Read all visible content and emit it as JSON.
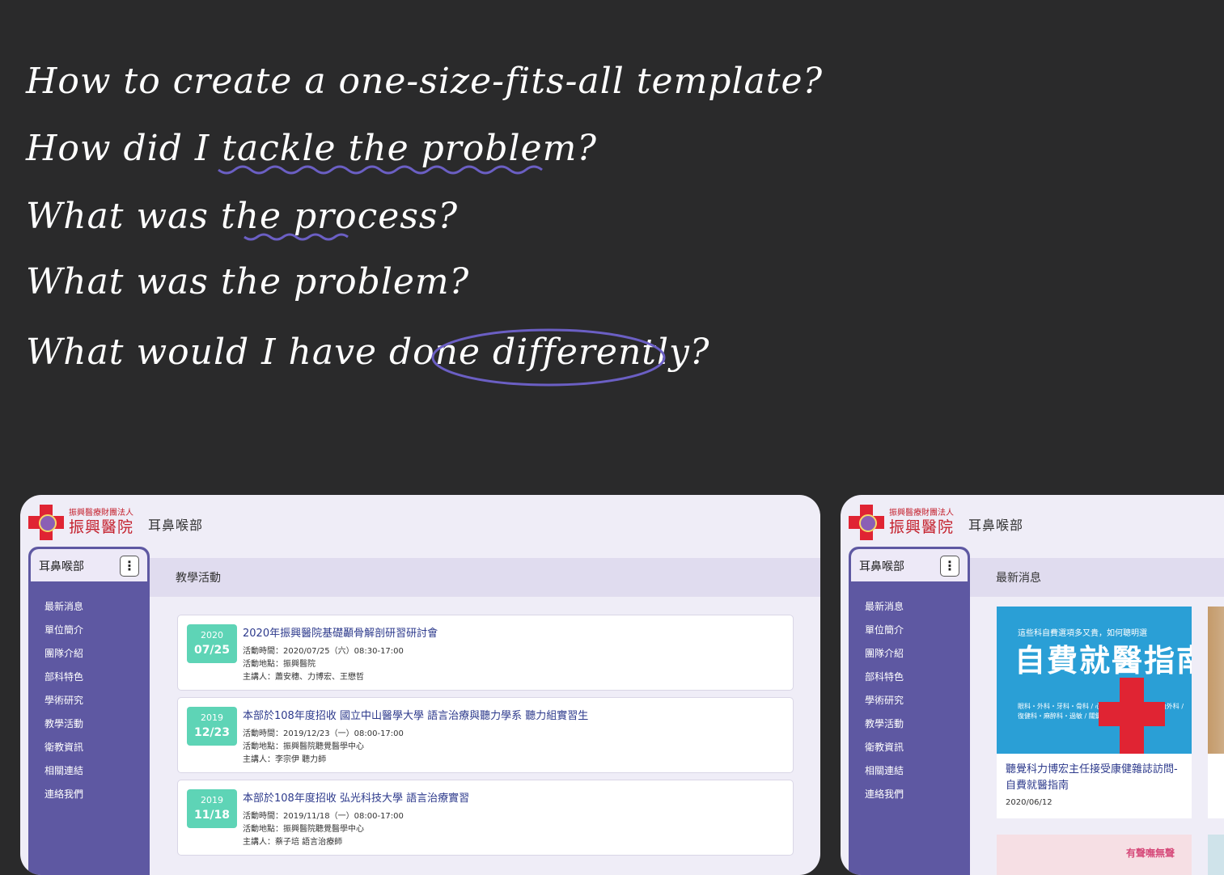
{
  "notes": [
    "How to create a one-size-fits-all template?",
    "How did I tackle the problem?",
    "What was the process?",
    "What was the problem?",
    "What would I have done differently?"
  ],
  "brand": {
    "foundation": "振興醫療財團法人",
    "hospital": "振興醫院",
    "department": "耳鼻喉部"
  },
  "sidebar": {
    "title": "耳鼻喉部",
    "items": [
      "最新消息",
      "單位簡介",
      "團隊介紹",
      "部科特色",
      "學術研究",
      "教學活動",
      "衛教資訊",
      "相關連結",
      "連絡我們"
    ]
  },
  "window1": {
    "header": "教學活動",
    "events": [
      {
        "year": "2020",
        "md": "07/25",
        "title": "2020年振興醫院基礎顳骨解剖研習研討會",
        "time": "活動時間：2020/07/25（六）08:30-17:00",
        "place": "活動地點：振興醫院",
        "speaker": "主講人：蕭安穗、力博宏、王懋哲"
      },
      {
        "year": "2019",
        "md": "12/23",
        "title": "本部於108年度招收 國立中山醫學大學 語言治療與聽力學系 聽力組實習生",
        "time": "活動時間：2019/12/23（一）08:00-17:00",
        "place": "活動地點：振興醫院聽覺醫學中心",
        "speaker": "主講人：李宗伊 聽力師"
      },
      {
        "year": "2019",
        "md": "11/18",
        "title": "本部於108年度招收 弘光科技大學 語言治療實習",
        "time": "活動時間：2019/11/18（一）08:00-17:00",
        "place": "活動地點：振興醫院聽覺醫學中心",
        "speaker": "主講人：蔡子培 語言治療師"
      }
    ]
  },
  "window2": {
    "header": "最新消息",
    "news": {
      "img_sub": "這些科自費選項多又貴，如何聰明選",
      "img_big": "自費就醫指南",
      "img_tags": "眼科・外科・牙科・骨科 / 心臟科・耳鼻喉・神經內外科 / 復健科・麻醉科・過敏 / 關鍵項目、手術全收錄",
      "title": "聽覺科力博宏主任接受康健雜誌訪問-自費就醫指南",
      "date": "2020/06/12"
    },
    "news3_text": "有聲嘸無聲"
  },
  "colors": {
    "background": "#2a2a2b",
    "window": "#efedf7",
    "sidebar": "#5e58a2",
    "header_band": "#e0dcef",
    "date_badge": "#5ed4b6",
    "link_text": "#2d3a8c",
    "annotation": "#6b5fc4",
    "brand_red": "#e02433"
  }
}
